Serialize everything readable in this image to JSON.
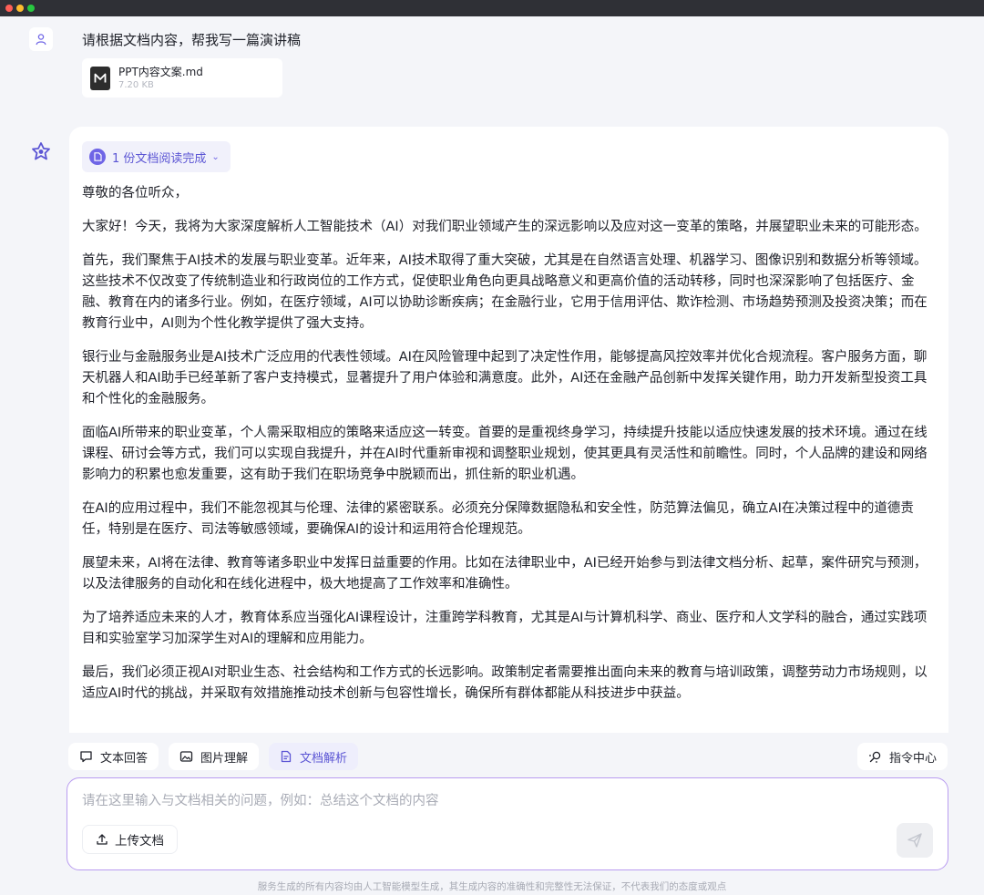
{
  "window": {
    "controls": [
      "close",
      "minimize",
      "maximize"
    ]
  },
  "user": {
    "avatar_icon": "user-icon",
    "message": "请根据文档内容，帮我写一篇演讲稿",
    "attachment": {
      "name": "PPT内容文案.md",
      "size": "7.20 KB",
      "icon": "markdown-file-icon"
    }
  },
  "assistant": {
    "avatar_icon": "bot-logo-icon",
    "doc_status": "1 份文档阅读完成",
    "paragraphs": [
      "尊敬的各位听众，",
      "大家好！今天，我将为大家深度解析人工智能技术（AI）对我们职业领域产生的深远影响以及应对这一变革的策略，并展望职业未来的可能形态。",
      "首先，我们聚焦于AI技术的发展与职业变革。近年来，AI技术取得了重大突破，尤其是在自然语言处理、机器学习、图像识别和数据分析等领域。这些技术不仅改变了传统制造业和行政岗位的工作方式，促使职业角色向更具战略意义和更高价值的活动转移，同时也深深影响了包括医疗、金融、教育在内的诸多行业。例如，在医疗领域，AI可以协助诊断疾病；在金融行业，它用于信用评估、欺诈检测、市场趋势预测及投资决策；而在教育行业中，AI则为个性化教学提供了强大支持。",
      "银行业与金融服务业是AI技术广泛应用的代表性领域。AI在风险管理中起到了决定性作用，能够提高风控效率并优化合规流程。客户服务方面，聊天机器人和AI助手已经革新了客户支持模式，显著提升了用户体验和满意度。此外，AI还在金融产品创新中发挥关键作用，助力开发新型投资工具和个性化的金融服务。",
      "面临AI所带来的职业变革，个人需采取相应的策略来适应这一转变。首要的是重视终身学习，持续提升技能以适应快速发展的技术环境。通过在线课程、研讨会等方式，我们可以实现自我提升，并在AI时代重新审视和调整职业规划，使其更具有灵活性和前瞻性。同时，个人品牌的建设和网络影响力的积累也愈发重要，这有助于我们在职场竞争中脱颖而出，抓住新的职业机遇。",
      "在AI的应用过程中，我们不能忽视其与伦理、法律的紧密联系。必须充分保障数据隐私和安全性，防范算法偏见，确立AI在决策过程中的道德责任，特别是在医疗、司法等敏感领域，要确保AI的设计和运用符合伦理规范。",
      "展望未来，AI将在法律、教育等诸多职业中发挥日益重要的作用。比如在法律职业中，AI已经开始参与到法律文档分析、起草，案件研究与预测，以及法律服务的自动化和在线化进程中，极大地提高了工作效率和准确性。",
      "为了培养适应未来的人才，教育体系应当强化AI课程设计，注重跨学科教育，尤其是AI与计算机科学、商业、医疗和人文学科的融合，通过实践项目和实验室学习加深学生对AI的理解和应用能力。",
      "最后，我们必须正视AI对职业生态、社会结构和工作方式的长远影响。政策制定者需要推出面向未来的教育与培训政策，调整劳动力市场规则，以适应AI时代的挑战，并采取有效措施推动技术创新与包容性增长，确保所有群体都能从科技进步中获益。"
    ]
  },
  "tools": {
    "text_answer": "文本回答",
    "image_understanding": "图片理解",
    "doc_analysis": "文档解析",
    "command_center": "指令中心"
  },
  "input": {
    "placeholder": "请在这里输入与文档相关的问题，例如：总结这个文档的内容",
    "upload_label": "上传文档"
  },
  "disclaimer": "服务生成的所有内容均由人工智能模型生成，其生成内容的准确性和完整性无法保证，不代表我们的态度或观点",
  "colors": {
    "accent": "#5b55d4",
    "input_border": "#b99cf0",
    "background": "#f4f5f9"
  }
}
